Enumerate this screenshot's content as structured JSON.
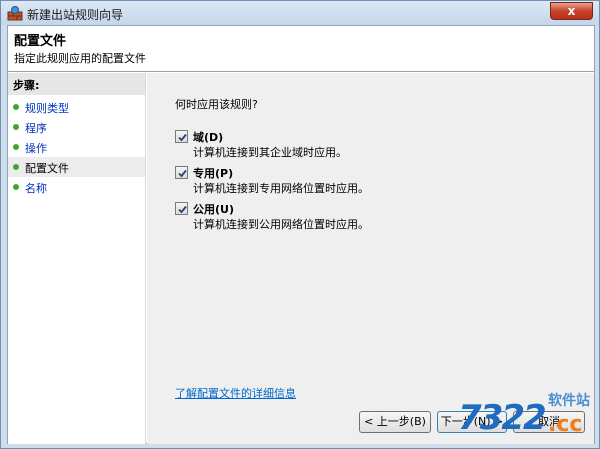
{
  "window": {
    "title": "新建出站规则向导",
    "close_glyph": "x"
  },
  "header": {
    "title": "配置文件",
    "subtitle": "指定此规则应用的配置文件"
  },
  "sidebar": {
    "label": "步骤:",
    "items": [
      {
        "label": "规则类型"
      },
      {
        "label": "程序"
      },
      {
        "label": "操作"
      },
      {
        "label": "配置文件"
      },
      {
        "label": "名称"
      }
    ],
    "current_index": 3
  },
  "main": {
    "question": "何时应用该规则?",
    "options": [
      {
        "label": "域(D)",
        "description": "计算机连接到其企业域时应用。",
        "checked": true
      },
      {
        "label": "专用(P)",
        "description": "计算机连接到专用网络位置时应用。",
        "checked": true
      },
      {
        "label": "公用(U)",
        "description": "计算机连接到公用网络位置时应用。",
        "checked": true
      }
    ],
    "link": "了解配置文件的详细信息"
  },
  "buttons": {
    "back": "< 上一步(B)",
    "next": "下一步(N) >",
    "cancel": "取消"
  },
  "watermark": {
    "top": "软件站",
    "number": "7322",
    "suffix": ".cc"
  },
  "colors": {
    "link": "#0066cc",
    "step_dot": "#3fa82a",
    "accent": "#1e6bc0"
  }
}
